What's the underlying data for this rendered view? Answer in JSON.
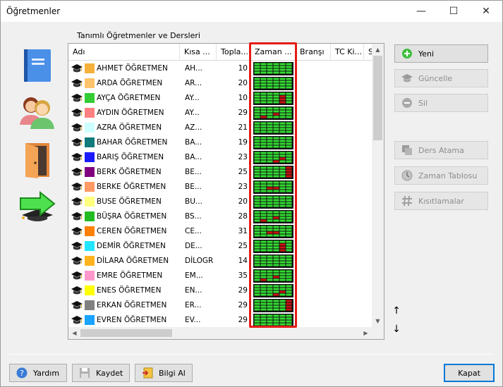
{
  "window": {
    "title": "Öğretmenler",
    "minimize": "—",
    "maximize": "☐",
    "close": "✕"
  },
  "section_label": "Tanımlı Öğretmenler ve Dersleri",
  "sidebar_icons": [
    "book-icon",
    "teachers-icon",
    "door-icon",
    "export-arrow-icon"
  ],
  "columns": [
    "Adı",
    "Kısa ...",
    "Topla...",
    "Zaman ...",
    "Branşı",
    "TC Ki...",
    "S"
  ],
  "teachers": [
    {
      "name": "AHMET ÖĞRETMEN",
      "short": "AH...",
      "total": "10",
      "color": "#f5b13a",
      "tt": "g"
    },
    {
      "name": "ARDA ÖĞRETMEN",
      "short": "AR...",
      "total": "20",
      "color": "#ffc36b",
      "tt": "g"
    },
    {
      "name": "AYÇA ÖĞRETMEN",
      "short": "AY...",
      "total": "10",
      "color": "#33cc33",
      "tt": "r1"
    },
    {
      "name": "AYDIN ÖĞRETMEN",
      "short": "AY...",
      "total": "29",
      "color": "#ff8080",
      "tt": "r2"
    },
    {
      "name": "AZRA ÖĞRETMEN",
      "short": "AZ...",
      "total": "21",
      "color": "#ccffff",
      "tt": "g"
    },
    {
      "name": "BAHAR ÖĞRETMEN",
      "short": "BA...",
      "total": "19",
      "color": "#117a7a",
      "tt": "g"
    },
    {
      "name": "BARIŞ ÖĞRETMEN",
      "short": "BA...",
      "total": "23",
      "color": "#1a1aff",
      "tt": "r3"
    },
    {
      "name": "BERK ÖĞRETMEN",
      "short": "BE...",
      "total": "25",
      "color": "#800080",
      "tt": "r4"
    },
    {
      "name": "BERKE ÖĞRETMEN",
      "short": "BE...",
      "total": "23",
      "color": "#ff9966",
      "tt": "r5"
    },
    {
      "name": "BUSE ÖĞRETMEN",
      "short": "BU...",
      "total": "20",
      "color": "#ffff80",
      "tt": "g"
    },
    {
      "name": "BÜŞRA ÖĞRETMEN",
      "short": "BS...",
      "total": "28",
      "color": "#22bb22",
      "tt": "r2"
    },
    {
      "name": "CEREN ÖĞRETMEN",
      "short": "CE...",
      "total": "31",
      "color": "#ff7f00",
      "tt": "r5"
    },
    {
      "name": "DEMİR ÖĞRETMEN",
      "short": "DE...",
      "total": "25",
      "color": "#22e5ff",
      "tt": "r1"
    },
    {
      "name": "DİLARA ÖĞRETMEN",
      "short": "DİLOGR",
      "total": "14",
      "color": "#ffb41e",
      "tt": "g"
    },
    {
      "name": "EMRE ÖĞRETMEN",
      "short": "EM...",
      "total": "35",
      "color": "#ff99cc",
      "tt": "r2"
    },
    {
      "name": "ENES ÖĞRETMEN",
      "short": "EN...",
      "total": "29",
      "color": "#ffff00",
      "tt": "r3"
    },
    {
      "name": "ERKAN ÖĞRETMEN",
      "short": "ER...",
      "total": "29",
      "color": "#808080",
      "tt": "r4"
    },
    {
      "name": "EVREN ÖĞRETMEN",
      "short": "EV...",
      "total": "29",
      "color": "#1aa3ff",
      "tt": "g"
    }
  ],
  "actions": [
    {
      "label": "Yeni",
      "icon": "plus-icon",
      "enabled": true
    },
    {
      "label": "Güncelle",
      "icon": "graduation-cap-icon",
      "enabled": false
    },
    {
      "label": "Sil",
      "icon": "minus-icon",
      "enabled": false
    },
    {
      "label": "Ders Atama",
      "icon": "copy-icon",
      "enabled": false
    },
    {
      "label": "Zaman Tablosu",
      "icon": "clock-icon",
      "enabled": false
    },
    {
      "label": "Kısıtlamalar",
      "icon": "hash-icon",
      "enabled": false
    }
  ],
  "move_up": "↑",
  "move_down": "↓",
  "footer": {
    "help": "Yardım",
    "save": "Kaydet",
    "info": "Bilgi Al",
    "close": "Kapat"
  },
  "colors": {
    "accent": "#0078d7",
    "highlight": "#e41b17",
    "timetable_free": "#33dd33",
    "timetable_busy": "#cc1111"
  }
}
